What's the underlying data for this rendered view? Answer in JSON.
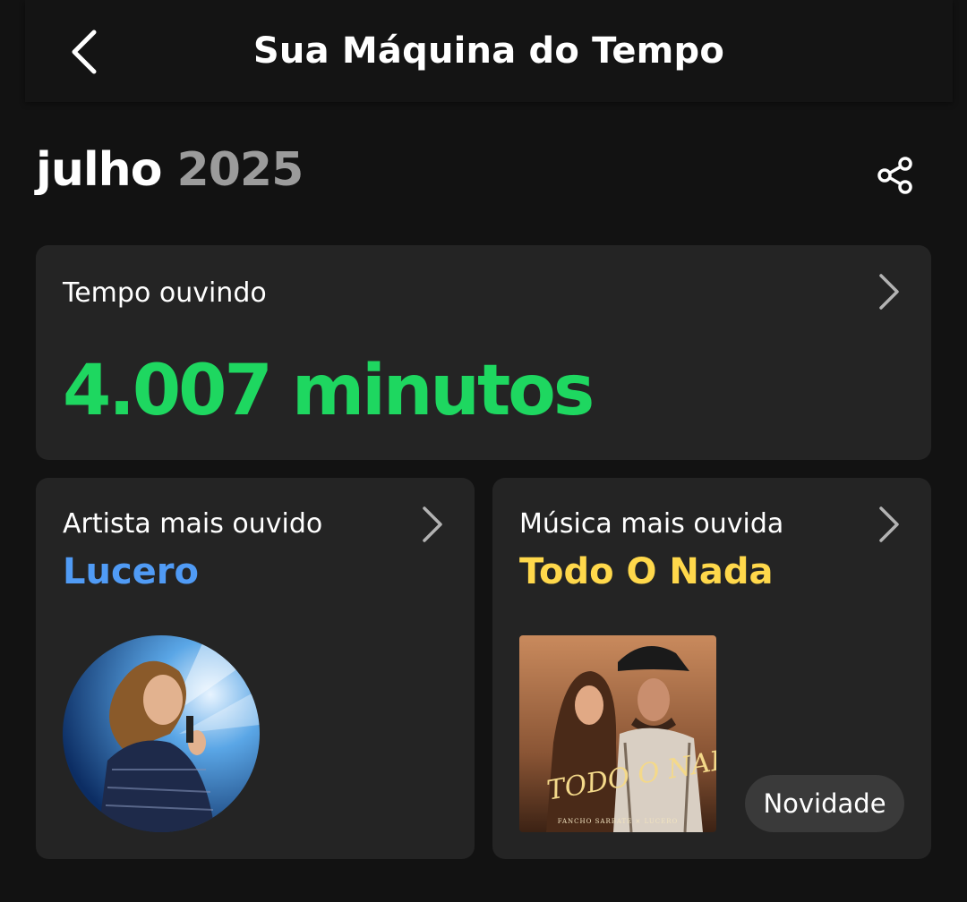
{
  "header": {
    "title": "Sua Máquina do Tempo",
    "back_icon": "chevron-left-icon"
  },
  "period": {
    "month": "julho",
    "year": "2025",
    "share_icon": "share-icon"
  },
  "listening_time": {
    "label": "Tempo ouvindo",
    "value": "4.007 minutos",
    "accent": "#1ed760"
  },
  "top_artist": {
    "label": "Artista mais ouvido",
    "name": "Lucero",
    "accent": "#509bf5"
  },
  "top_song": {
    "label": "Música mais ouvida",
    "name": "Todo O Nada",
    "badge": "Novidade",
    "accent": "#ffd84b",
    "cover_text": "TODO O NADA",
    "cover_credit": "FANCHO SARBATE × LUCERO"
  }
}
